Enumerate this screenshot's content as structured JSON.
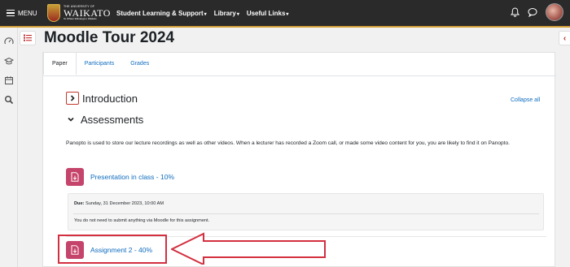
{
  "topbar": {
    "menu_label": "MENU",
    "logo": {
      "line1": "THE UNIVERSITY OF",
      "name": "WAIKATO",
      "line3": "Te Whare Wānanga o Waikato"
    },
    "nav": [
      {
        "label": "Student Learning & Support"
      },
      {
        "label": "Library"
      },
      {
        "label": "Useful Links"
      }
    ],
    "icons": [
      "bell-icon",
      "chat-icon",
      "avatar"
    ]
  },
  "left_rail": {
    "icons": [
      "dashboard-icon",
      "graduation-cap-icon",
      "calendar-icon",
      "search-icon"
    ]
  },
  "page": {
    "title": "Moodle Tour 2024"
  },
  "tabs": [
    {
      "label": "Paper",
      "active": true
    },
    {
      "label": "Participants",
      "active": false
    },
    {
      "label": "Grades",
      "active": false
    }
  ],
  "course": {
    "collapse_all": "Collapse all",
    "sections": [
      {
        "title": "Introduction",
        "collapsed": true
      },
      {
        "title": "Assessments",
        "collapsed": false
      }
    ],
    "summary": "Panopto is used to store our lecture recordings as well as other videos. When a lecturer has recorded a Zoom call, or made some video content for you, you are likely to find it on Panopto.",
    "activities": [
      {
        "name": "Presentation in class - 10%",
        "due_label": "Due:",
        "due_value": "Sunday, 31 December 2023, 10:00 AM",
        "note": "You do not need to submit anything via Moodle for this assignment."
      },
      {
        "name": "Assignment 2 - 40%"
      }
    ]
  },
  "colors": {
    "accent_link": "#0f6cbf",
    "activity_icon": "#c5446b",
    "annotation_red": "#d32f3f",
    "gold": "#d7a13a"
  }
}
